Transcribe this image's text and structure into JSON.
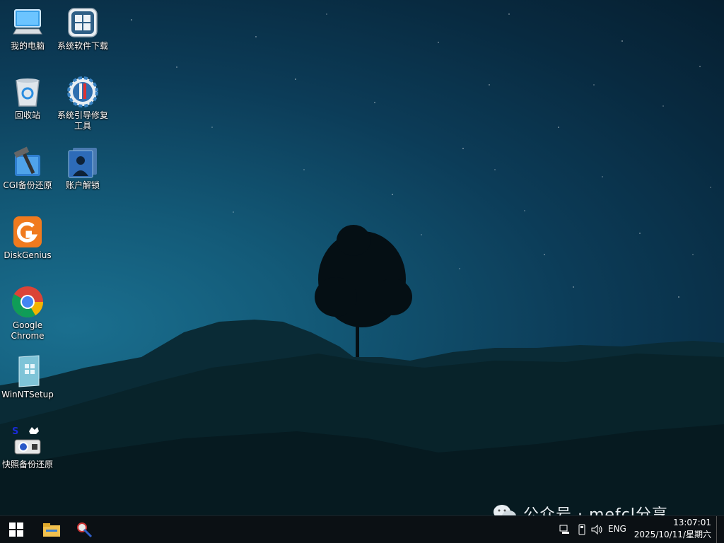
{
  "desktop_icons": [
    {
      "id": "my-computer",
      "label": "我的电脑",
      "icon": "computer-icon"
    },
    {
      "id": "system-software-download",
      "label": "系统软件下载",
      "icon": "app-store-icon"
    },
    {
      "id": "recycle-bin",
      "label": "回收站",
      "icon": "recycle-bin-icon"
    },
    {
      "id": "boot-repair-tool",
      "label": "系统引导修复\n工具",
      "icon": "gear-tools-icon"
    },
    {
      "id": "cgi-backup-restore",
      "label": "CGI备份还原",
      "icon": "hammer-icon"
    },
    {
      "id": "account-unlock",
      "label": "账户解锁",
      "icon": "user-silhouette-icon"
    },
    {
      "id": "diskgenius",
      "label": "DiskGenius",
      "icon": "diskgenius-icon"
    },
    {
      "id": "google-chrome",
      "label": "Google\nChrome",
      "icon": "chrome-icon"
    },
    {
      "id": "winntsetup",
      "label": "WinNTSetup",
      "icon": "winntsetup-icon"
    },
    {
      "id": "snapshot-backup",
      "label": "快照备份还原",
      "icon": "snapshot-icon"
    }
  ],
  "taskbar": {
    "start_icon": "windows-start-icon",
    "pinned": [
      "file-explorer-icon",
      "paint-tool-icon"
    ],
    "tray": {
      "network_icon": "network-icon",
      "usb_icon": "usb-icon",
      "volume_icon": "volume-icon",
      "language": "ENG",
      "time": "13:07:01",
      "date": "2025/10/11/星期六"
    }
  },
  "watermark": {
    "text": "公众号 · mefcl分享",
    "icon": "wechat-icon"
  },
  "colors": {
    "taskbar_bg": "#0b1014",
    "sky_accent": "#135a78"
  }
}
